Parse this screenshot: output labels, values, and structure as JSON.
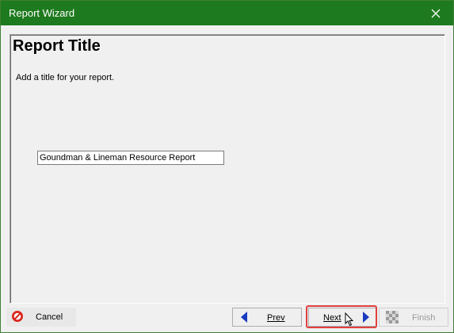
{
  "window": {
    "title": "Report Wizard"
  },
  "page": {
    "heading": "Report Title",
    "subtitle": "Add a title for your report."
  },
  "title_field": {
    "value": "Goundman & Lineman Resource Report"
  },
  "buttons": {
    "cancel": "Cancel",
    "prev": "Prev",
    "next": "Next",
    "finish": "Finish"
  },
  "colors": {
    "titlebar": "#1e7a1e",
    "cancel_icon": "#d9261c",
    "arrow": "#1b3bbf",
    "highlight": "#e0403f"
  },
  "icons": {
    "close": "close-icon",
    "cancel": "no-entry-icon",
    "prev": "left-triangle-icon",
    "next": "right-triangle-icon",
    "finish": "checkered-flag-icon"
  }
}
